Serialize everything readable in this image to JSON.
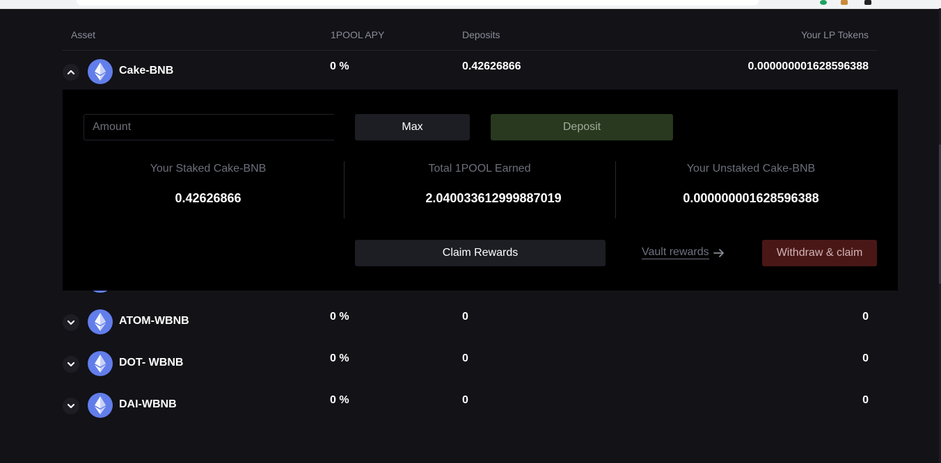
{
  "table": {
    "headers": {
      "asset": "Asset",
      "apy": "1POOL APY",
      "deposits": "Deposits",
      "lp_tokens": "Your LP Tokens"
    },
    "rows": [
      {
        "asset": "Cake-BNB",
        "apy": "0 %",
        "deposits": "0.42626866",
        "lp_tokens": "0.000000001628596388",
        "expanded": true
      },
      {
        "asset": "ATOM-WBNB",
        "apy": "0 %",
        "deposits": "0",
        "lp_tokens": "0",
        "expanded": false
      },
      {
        "asset": "DOT- WBNB",
        "apy": "0 %",
        "deposits": "0",
        "lp_tokens": "0",
        "expanded": false
      },
      {
        "asset": "DAI-WBNB",
        "apy": "0 %",
        "deposits": "0",
        "lp_tokens": "0",
        "expanded": false
      }
    ]
  },
  "panel": {
    "amount_placeholder": "Amount",
    "max_label": "Max",
    "deposit_label": "Deposit",
    "stats": [
      {
        "label": "Your Staked Cake-BNB",
        "value": "0.42626866"
      },
      {
        "label": "Total 1POOL Earned",
        "value": "2.040033612999887019"
      },
      {
        "label": "Your Unstaked Cake-BNB",
        "value": "0.000000001628596388"
      }
    ],
    "claim_label": "Claim Rewards",
    "vault_rewards_label": "Vault rewards",
    "withdraw_label": "Withdraw & claim"
  },
  "colors": {
    "background": "#121217",
    "panel": "#000000",
    "deposit_button": "#28391f",
    "withdraw_button": "#4a1717",
    "coin": "#627eea"
  },
  "icons": {
    "coin": "ethereum-icon",
    "expand": "chevron-down-icon",
    "collapse": "chevron-up-icon",
    "vault_arrow": "arrow-right-icon"
  }
}
